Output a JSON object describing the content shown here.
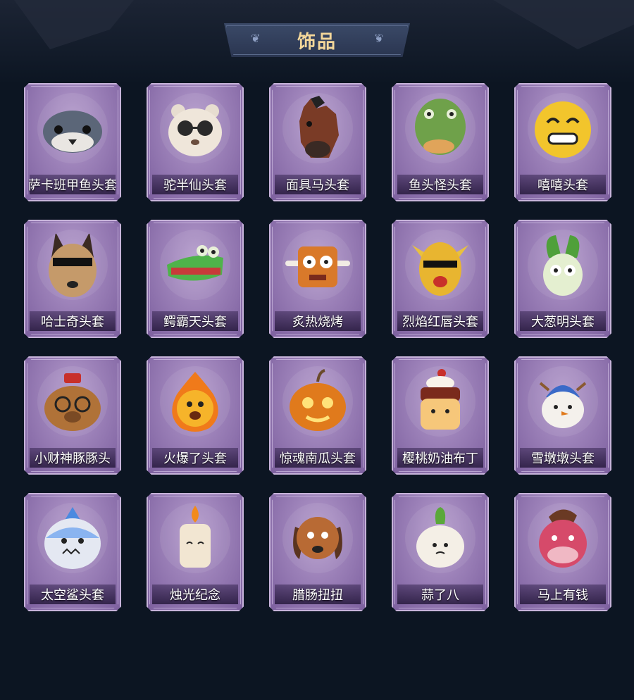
{
  "header": {
    "title": "饰品"
  },
  "items": [
    {
      "label": "萨卡班甲鱼头套",
      "icon": "fish-head-icon"
    },
    {
      "label": "驼半仙头套",
      "icon": "bear-sunglasses-icon"
    },
    {
      "label": "面具马头套",
      "icon": "horse-mask-icon"
    },
    {
      "label": "鱼头怪头套",
      "icon": "fish-monster-icon"
    },
    {
      "label": "嘻嘻头套",
      "icon": "grin-emoji-icon"
    },
    {
      "label": "哈士奇头套",
      "icon": "husky-icon"
    },
    {
      "label": "鳄霸天头套",
      "icon": "crocodile-icon"
    },
    {
      "label": "炙热烧烤",
      "icon": "bbq-meat-icon"
    },
    {
      "label": "烈焰红唇头套",
      "icon": "yellow-mask-icon"
    },
    {
      "label": "大葱明头套",
      "icon": "scallion-icon"
    },
    {
      "label": "小财神豚豚头",
      "icon": "capybara-icon"
    },
    {
      "label": "火爆了头套",
      "icon": "fireball-icon"
    },
    {
      "label": "惊魂南瓜头套",
      "icon": "pumpkin-icon"
    },
    {
      "label": "樱桃奶油布丁",
      "icon": "pudding-icon"
    },
    {
      "label": "雪墩墩头套",
      "icon": "snowman-icon"
    },
    {
      "label": "太空鲨头套",
      "icon": "shark-icon"
    },
    {
      "label": "烛光纪念",
      "icon": "candle-icon"
    },
    {
      "label": "腊肠扭扭",
      "icon": "dachshund-icon"
    },
    {
      "label": "蒜了八",
      "icon": "garlic-icon"
    },
    {
      "label": "马上有钱",
      "icon": "pink-horse-icon"
    }
  ],
  "colors": {
    "background": "#0c1522",
    "card_purple": "#9a7fb7",
    "title_gold": "#f4d79a"
  }
}
